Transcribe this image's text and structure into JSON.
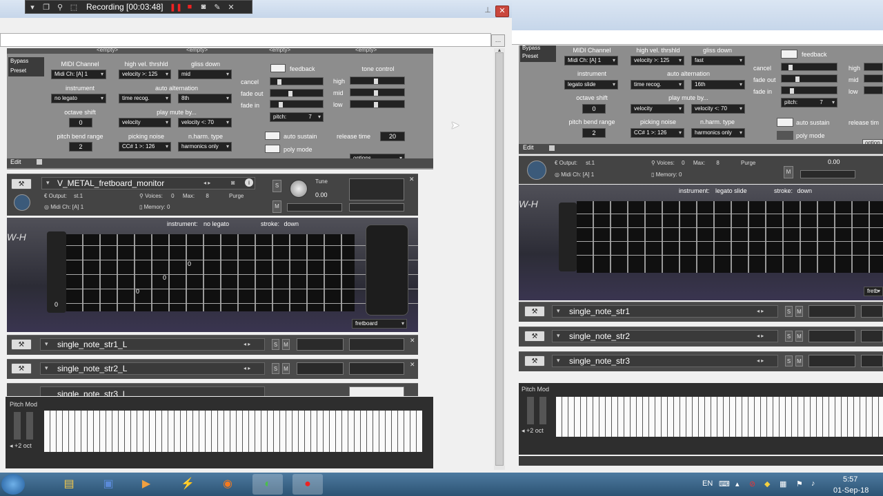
{
  "recorder": {
    "title": "Recording [00:03:48]"
  },
  "left": {
    "tabs": [
      "<empty>",
      "<empty>",
      "<empty>",
      "<empty>"
    ],
    "top_left": {
      "bypass": "Bypass",
      "preset": "Preset"
    },
    "midi_channel": {
      "label": "MIDI Channel",
      "value": "Midi Ch: [A] 1"
    },
    "high_vel": {
      "label": "high vel. thrshld",
      "value_label": "velocity >:",
      "value": "125"
    },
    "gliss_down": {
      "label": "gliss down",
      "value": "mid"
    },
    "instrument": {
      "label": "instrument",
      "value": "no legato"
    },
    "auto_alternation": {
      "label": "auto alternation",
      "value": "time recog.",
      "value2": "8th"
    },
    "octave_shift": {
      "label": "octave shift",
      "value": "0"
    },
    "play_mute_by": {
      "label": "play mute by...",
      "value": "velocity",
      "value2_label": "velocity <:",
      "value2": "70"
    },
    "pitch_bend": {
      "label": "pitch bend range",
      "value": "2"
    },
    "picking_noise": {
      "label": "picking noise",
      "value": "CC# 1 >:",
      "value2": "126"
    },
    "nharm": {
      "label": "n.harm. type",
      "value": "harmonics only"
    },
    "feedback": {
      "label": "feedback",
      "cancel": "cancel",
      "fade_out": "fade out",
      "fade_in": "fade in",
      "pitch_label": "pitch:",
      "pitch": "7"
    },
    "tone_control": {
      "label": "tone control",
      "high": "high",
      "mid": "mid",
      "low": "low"
    },
    "auto_sustain": "auto sustain",
    "poly_mode": "poly mode",
    "release_time": {
      "label": "release time",
      "value": "20"
    },
    "options": "options...",
    "edit": "Edit",
    "inst": {
      "name": "V_METAL_fretboard_monitor",
      "output_label": "Output:",
      "output": "st.1",
      "voices_label": "Voices:",
      "voices": "0",
      "max_label": "Max:",
      "max": "8",
      "purge": "Purge",
      "midi_label": "Midi Ch:",
      "midi": "[A] 1",
      "memory_label": "Memory:",
      "memory": "0",
      "tune_label": "Tune",
      "tune": "0.00"
    },
    "fret_info": {
      "instrument_label": "instrument:",
      "instrument": "no legato",
      "stroke_label": "stroke:",
      "stroke": "down",
      "fret_marks": [
        "0",
        "0",
        "0",
        "0"
      ],
      "view": "fretboard"
    },
    "slots": [
      "single_note_str1_L",
      "single_note_str2_L",
      "single_note_str3_L"
    ],
    "pitch_mod": "Pitch Mod",
    "octave": "+2 oct"
  },
  "right": {
    "top_left": {
      "bypass": "Bypass",
      "preset": "Preset"
    },
    "midi_channel": {
      "label": "MIDI Channel",
      "value": "Midi Ch: [A] 1"
    },
    "high_vel": {
      "label": "high vel. thrshld",
      "value_label": "velocity >:",
      "value": "125"
    },
    "gliss_down": {
      "label": "gliss down",
      "value": "fast"
    },
    "instrument": {
      "label": "instrument",
      "value": "legato slide"
    },
    "auto_alternation": {
      "label": "auto alternation",
      "value": "time recog.",
      "value2": "16th"
    },
    "octave_shift": {
      "label": "octave shift",
      "value": "0"
    },
    "play_mute_by": {
      "label": "play mute by...",
      "value": "velocity",
      "value2_label": "velocity <:",
      "value2": "70"
    },
    "pitch_bend": {
      "label": "pitch bend range",
      "value": "2"
    },
    "picking_noise": {
      "label": "picking noise",
      "value": "CC# 1 >:",
      "value2": "126"
    },
    "nharm": {
      "label": "n.harm. type",
      "value": "harmonics only"
    },
    "feedback": {
      "label": "feedback",
      "cancel": "cancel",
      "fade_out": "fade out",
      "fade_in": "fade in",
      "pitch_label": "pitch:",
      "pitch": "7"
    },
    "tone_control": {
      "high": "high",
      "mid": "mid",
      "low": "low"
    },
    "auto_sustain": "auto sustain",
    "poly_mode": "poly mode",
    "release_time": {
      "label": "release tim"
    },
    "options": "option",
    "edit": "Edit",
    "inst": {
      "output_label": "Output:",
      "output": "st.1",
      "voices_label": "Voices:",
      "voices": "0",
      "max_label": "Max:",
      "max": "8",
      "purge": "Purge",
      "midi_label": "Midi Ch:",
      "midi": "[A] 1",
      "memory_label": "Memory:",
      "memory": "0",
      "tune": "0.00"
    },
    "fret_info": {
      "instrument_label": "instrument:",
      "instrument": "legato slide",
      "stroke_label": "stroke:",
      "stroke": "down",
      "view": "fretb"
    },
    "slots": [
      "single_note_str1",
      "single_note_str2",
      "single_note_str3"
    ],
    "pitch_mod": "Pitch Mod",
    "octave": "+2 oct"
  },
  "taskbar": {
    "lang": "EN",
    "time": "5:57",
    "date": "01-Sep-18"
  }
}
